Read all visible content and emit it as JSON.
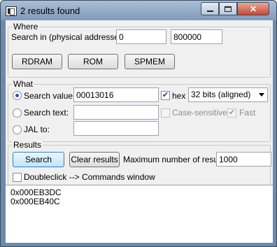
{
  "window": {
    "title": "2 results found"
  },
  "where": {
    "group_label": "Where",
    "search_in_label": "Search in (physical addresses):",
    "start_address": "0",
    "end_address": "800000",
    "buttons": {
      "rdram": "RDRAM",
      "rom": "ROM",
      "spmem": "SPMEM"
    }
  },
  "what": {
    "group_label": "What",
    "search_value_label": "Search value:",
    "search_value": "00013016",
    "hex_label": "hex",
    "hex_checked": true,
    "size_selected": "32 bits (aligned)",
    "search_text_label": "Search text:",
    "search_text": "",
    "case_sensitive_label": "Case-sensitive",
    "fast_label": "Fast",
    "jal_label": "JAL to:",
    "jal_value": "",
    "selected_mode": "search-value"
  },
  "results": {
    "group_label": "Results",
    "search_button": "Search",
    "clear_button": "Clear results",
    "max_label": "Maximum number of results:",
    "max_value": "1000",
    "doubleclick_label": "Doubleclick --> Commands window",
    "items": [
      "0x000EB3DC",
      "0x000EB40C"
    ]
  }
}
